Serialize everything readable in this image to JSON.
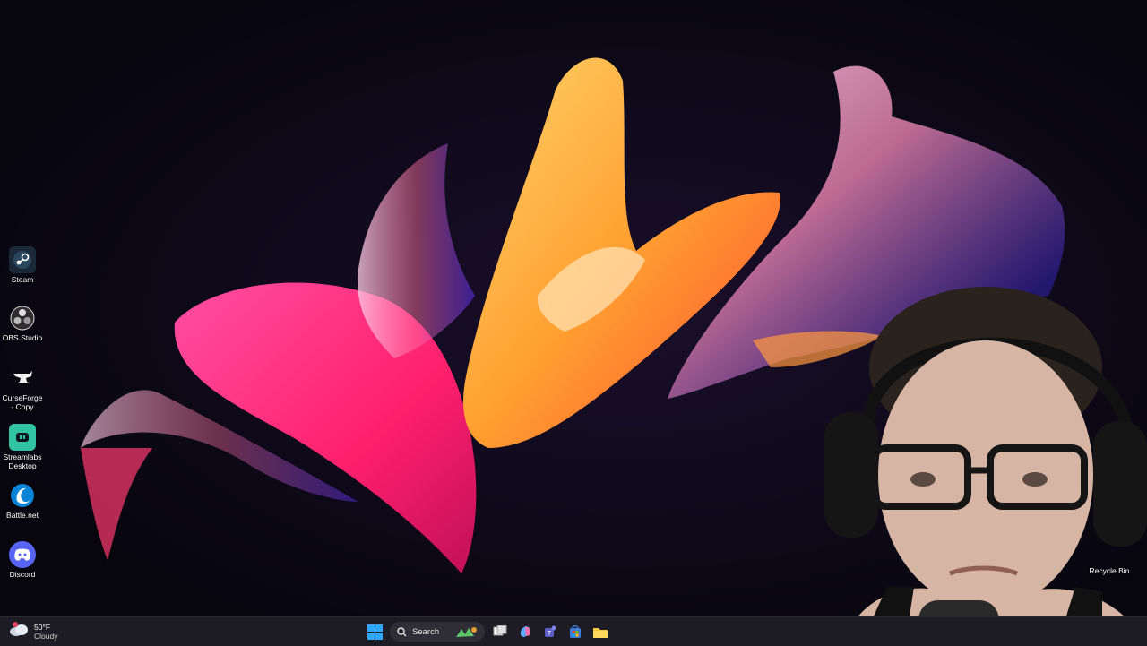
{
  "desktop": {
    "icons": [
      {
        "label": "Steam",
        "icon": "steam-icon"
      },
      {
        "label": "OBS Studio",
        "icon": "obs-icon"
      },
      {
        "label": "CurseForge - Copy",
        "icon": "curseforge-icon"
      },
      {
        "label": "Streamlabs Desktop",
        "icon": "streamlabs-icon"
      },
      {
        "label": "Battle.net",
        "icon": "battlenet-icon"
      },
      {
        "label": "Discord",
        "icon": "discord-icon"
      }
    ],
    "recycle_bin": {
      "label": "Recycle Bin",
      "icon": "recycle-bin-icon"
    }
  },
  "taskbar": {
    "weather": {
      "temp": "50°F",
      "condition": "Cloudy",
      "icon": "cloud-icon"
    },
    "start_icon": "windows-logo-icon",
    "search": {
      "label": "Search",
      "icon": "search-icon"
    },
    "apps": [
      {
        "name": "task-view",
        "icon": "task-view-icon"
      },
      {
        "name": "copilot",
        "icon": "copilot-icon"
      },
      {
        "name": "teams",
        "icon": "teams-icon"
      },
      {
        "name": "microsoft-store",
        "icon": "store-icon"
      },
      {
        "name": "file-explorer",
        "icon": "folder-icon"
      }
    ]
  },
  "colors": {
    "taskbar_bg": "#1d1c24",
    "wallpaper_bg": "#07060f",
    "accent": "#0a84d8"
  }
}
